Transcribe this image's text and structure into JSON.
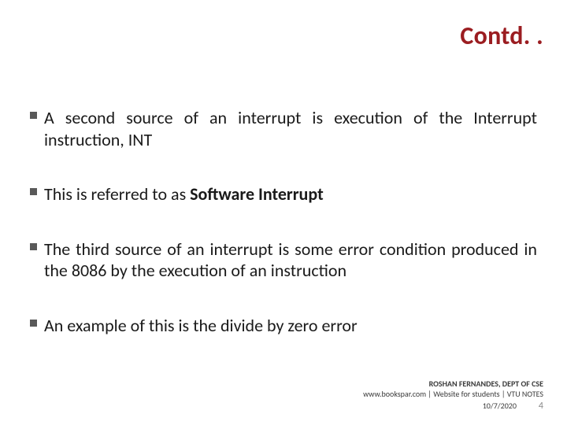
{
  "title": "Contd. .",
  "bullets": [
    {
      "pre": "A second source of an interrupt is execution of the Interrupt instruction, INT",
      "bold": "",
      "post": ""
    },
    {
      "pre": "This is referred to as ",
      "bold": "Software Interrupt",
      "post": ""
    },
    {
      "pre": "The third source of an interrupt is some error condition produced in the 8086 by the execution of an instruction",
      "bold": "",
      "post": ""
    },
    {
      "pre": "An example of this is the divide by zero error",
      "bold": "",
      "post": ""
    }
  ],
  "footer": {
    "author": "ROSHAN FERNANDES, DEPT OF CSE",
    "site": "www.bookspar.com | Website for students | VTU NOTES",
    "date": "10/7/2020",
    "page": "4"
  }
}
